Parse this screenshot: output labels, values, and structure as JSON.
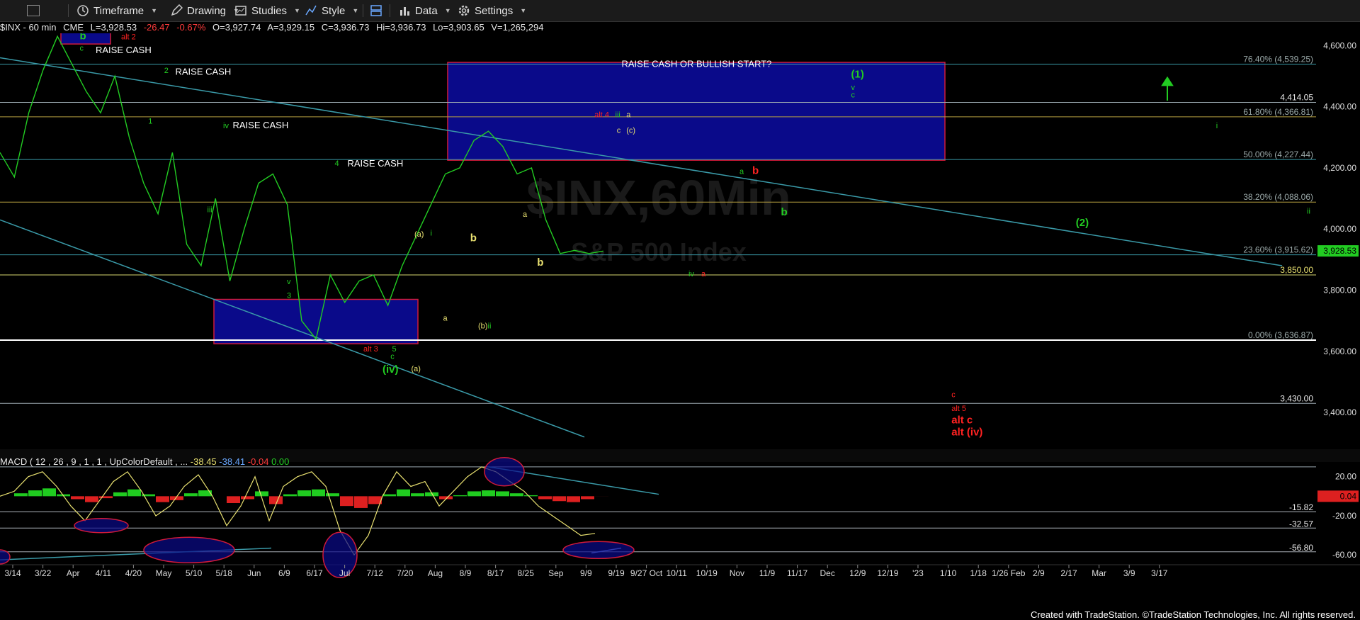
{
  "toolbar": {
    "timeframe": "Timeframe",
    "drawing": "Drawing",
    "studies": "Studies",
    "style": "Style",
    "data": "Data",
    "settings": "Settings"
  },
  "symbol_info": {
    "symbol": "$INX - 60 min",
    "exchange": "CME",
    "last": "L=3,928.53",
    "change": "-26.47",
    "change_pct": "-0.67%",
    "open": "O=3,927.74",
    "prev": "A=3,929.15",
    "close": "C=3,936.73",
    "high": "Hi=3,936.73",
    "low": "Lo=3,903.65",
    "volume": "V=1,265,294"
  },
  "macd_info": {
    "label": "MACD ( 12 , 26 , 9 , 1 , 1 , UpColorDefault , ...",
    "v1": "-38.45",
    "v2": "-38.41",
    "v3": "-0.04",
    "v4": "0.00"
  },
  "footer": "Created with TradeStation. ©TradeStation Technologies, Inc. All rights reserved.",
  "colors": {
    "price_line": "#22cc22",
    "box_fill": "#0a0a8a",
    "box_border": "#d01a3a",
    "trend_line": "#3a9aa8",
    "macd_line": "#e8e070",
    "hist_pos": "#20cc20",
    "hist_neg": "#dd2020"
  },
  "chart_data": {
    "type": "line",
    "title": "$INX,60Min",
    "subtitle": "S&P 500 Index",
    "x_ticks": [
      "3/14",
      "3/22",
      "Apr",
      "4/11",
      "4/20",
      "May",
      "5/10",
      "5/18",
      "Jun",
      "6/9",
      "6/17",
      "Jul",
      "7/12",
      "7/20",
      "Aug",
      "8/9",
      "8/17",
      "8/25",
      "Sep",
      "9/9",
      "9/19",
      "9/27 Oct",
      "10/11",
      "10/19",
      "Nov",
      "11/9",
      "11/17",
      "Dec",
      "12/9",
      "12/19",
      "'23",
      "1/10",
      "1/18",
      "1/26 Feb",
      "2/9",
      "2/17",
      "Mar",
      "3/9",
      "3/17"
    ],
    "price_ylim": [
      3280,
      4640
    ],
    "price_y_ticks": [
      "4,600.00",
      "4,400.00",
      "4,200.00",
      "4,000.00",
      "3,800.00",
      "3,600.00",
      "3,400.00"
    ],
    "price_y_values": [
      4600,
      4400,
      4200,
      4000,
      3800,
      3600,
      3400
    ],
    "last_price": "3,928.53",
    "series": [
      {
        "name": "",
        "x": [
          0,
          2,
          4,
          6,
          8,
          10,
          12,
          14,
          16,
          18,
          20,
          22,
          24,
          26,
          28,
          30,
          32,
          34,
          36,
          38,
          40,
          42,
          44,
          46,
          48,
          50,
          52,
          54,
          56,
          58,
          60,
          62,
          64,
          66,
          68,
          70,
          72,
          74,
          76,
          78,
          80,
          82,
          84
        ],
        "values": [
          4250,
          4170,
          4380,
          4520,
          4630,
          4540,
          4450,
          4380,
          4500,
          4300,
          4150,
          4050,
          4250,
          3950,
          3880,
          4100,
          3830,
          4000,
          4150,
          4180,
          4080,
          3700,
          3640,
          3850,
          3760,
          3830,
          3850,
          3750,
          3880,
          3980,
          4080,
          4180,
          4200,
          4290,
          4320,
          4270,
          4180,
          4200,
          4030,
          3920,
          3930,
          3920,
          3928
        ]
      }
    ],
    "fib_levels": [
      {
        "label": "76.40% (4,539.25)",
        "value": 4539.25
      },
      {
        "label": "4,414.05",
        "value": 4414.05
      },
      {
        "label": "61.80% (4,366.81)",
        "value": 4366.81
      },
      {
        "label": "50.00% (4,227.44)",
        "value": 4227.44
      },
      {
        "label": "38.20% (4,088.06)",
        "value": 4088.06
      },
      {
        "label": "23.60% (3,915.62)",
        "value": 3915.62
      },
      {
        "label": "3,850.00",
        "value": 3850
      },
      {
        "label": "0.00% (3,636.87)",
        "value": 3636.87
      },
      {
        "label": "3,430.00",
        "value": 3430
      }
    ],
    "annotations": [
      {
        "text": "b",
        "x": 5,
        "y": 4620,
        "color": "#22cc22"
      },
      {
        "text": "alt 2",
        "x": 7.6,
        "y": 4620,
        "color": "#ff2222"
      },
      {
        "text": "c",
        "x": 5,
        "y": 4583,
        "color": "#22cc22"
      },
      {
        "text": "RAISE CASH",
        "x": 6,
        "y": 4575,
        "color": "#ffffff"
      },
      {
        "text": "2",
        "x": 10.3,
        "y": 4510,
        "color": "#22cc22"
      },
      {
        "text": "RAISE CASH",
        "x": 11,
        "y": 4505,
        "color": "#ffffff"
      },
      {
        "text": "1",
        "x": 9.3,
        "y": 4345,
        "color": "#22cc22"
      },
      {
        "text": "iv",
        "x": 14,
        "y": 4330,
        "color": "#22cc22"
      },
      {
        "text": "RAISE CASH",
        "x": 14.6,
        "y": 4330,
        "color": "#ffffff"
      },
      {
        "text": "4",
        "x": 21,
        "y": 4207,
        "color": "#22cc22"
      },
      {
        "text": "RAISE CASH",
        "x": 21.8,
        "y": 4205,
        "color": "#ffffff"
      },
      {
        "text": "iii",
        "x": 13,
        "y": 4055,
        "color": "#22cc22"
      },
      {
        "text": "v",
        "x": 18,
        "y": 3820,
        "color": "#22cc22"
      },
      {
        "text": "3",
        "x": 18,
        "y": 3775,
        "color": "#22cc22"
      },
      {
        "text": "alt 3",
        "x": 22.8,
        "y": 3600,
        "color": "#ff2222"
      },
      {
        "text": "5",
        "x": 24.6,
        "y": 3600,
        "color": "#22cc22"
      },
      {
        "text": "c",
        "x": 24.5,
        "y": 3575,
        "color": "#22cc22"
      },
      {
        "text": "(iv)",
        "x": 24,
        "y": 3530,
        "color": "#22cc22"
      },
      {
        "text": "(a)",
        "x": 25.8,
        "y": 3535,
        "color": "#e8e070"
      },
      {
        "text": "(a)",
        "x": 26,
        "y": 3975,
        "color": "#e8e070"
      },
      {
        "text": "i",
        "x": 27,
        "y": 3978,
        "color": "#22cc22"
      },
      {
        "text": "a",
        "x": 27.8,
        "y": 3700,
        "color": "#e8e070"
      },
      {
        "text": "b",
        "x": 29.5,
        "y": 3960,
        "color": "#e8e070"
      },
      {
        "text": "(b)",
        "x": 30,
        "y": 3675,
        "color": "#e8e070"
      },
      {
        "text": "ii",
        "x": 30.6,
        "y": 3675,
        "color": "#22cc22"
      },
      {
        "text": "a",
        "x": 32.8,
        "y": 4040,
        "color": "#e8e070"
      },
      {
        "text": "b",
        "x": 33.7,
        "y": 3880,
        "color": "#e8e070"
      },
      {
        "text": "alt 4",
        "x": 37.3,
        "y": 4365,
        "color": "#ff2222"
      },
      {
        "text": "iii",
        "x": 38.6,
        "y": 4365,
        "color": "#22cc22"
      },
      {
        "text": "a",
        "x": 39.3,
        "y": 4365,
        "color": "#e8e070"
      },
      {
        "text": "c",
        "x": 38.7,
        "y": 4315,
        "color": "#e8e070"
      },
      {
        "text": "(c)",
        "x": 39.3,
        "y": 4315,
        "color": "#e8e070"
      },
      {
        "text": "a",
        "x": 46.4,
        "y": 4180,
        "color": "#22cc22"
      },
      {
        "text": "b",
        "x": 47.2,
        "y": 4180,
        "color": "#ff2222"
      },
      {
        "text": "b",
        "x": 49,
        "y": 4045,
        "color": "#22cc22"
      },
      {
        "text": "iv",
        "x": 43.2,
        "y": 3845,
        "color": "#22cc22"
      },
      {
        "text": "a",
        "x": 44,
        "y": 3845,
        "color": "#ff2222"
      },
      {
        "text": "RAISE CASH OR BULLISH START?",
        "x": 39,
        "y": 4530,
        "color": "#ffffff"
      },
      {
        "text": "(1)",
        "x": 53.4,
        "y": 4495,
        "color": "#22cc22"
      },
      {
        "text": "v",
        "x": 53.4,
        "y": 4455,
        "color": "#22cc22"
      },
      {
        "text": "c",
        "x": 53.4,
        "y": 4430,
        "color": "#22cc22"
      },
      {
        "text": "(2)",
        "x": 67.5,
        "y": 4010,
        "color": "#22cc22"
      },
      {
        "text": "i",
        "x": 76.3,
        "y": 4330,
        "color": "#22cc22"
      },
      {
        "text": "ii",
        "x": 82,
        "y": 4050,
        "color": "#22cc22"
      },
      {
        "text": "c",
        "x": 59.7,
        "y": 3450,
        "color": "#ff2222"
      },
      {
        "text": "alt 5",
        "x": 59.7,
        "y": 3405,
        "color": "#ff2222"
      },
      {
        "text": "alt c",
        "x": 59.7,
        "y": 3365,
        "color": "#ff2222"
      },
      {
        "text": "alt (iv)",
        "x": 59.7,
        "y": 3325,
        "color": "#ff2222"
      }
    ],
    "macd": {
      "ylim": [
        -70,
        35
      ],
      "y_ticks": [
        "20.00",
        "-20.00",
        "-60.00"
      ],
      "y_values": [
        20,
        -20,
        -60
      ],
      "levels": [
        {
          "label": "-15.82",
          "value": -15.82
        },
        {
          "label": "-32.57",
          "value": -32.57
        },
        {
          "label": "-56.80",
          "value": -56.8
        }
      ],
      "last": "0.04",
      "macd_line": [
        0,
        5,
        20,
        25,
        10,
        -10,
        -25,
        -5,
        15,
        25,
        5,
        -20,
        -10,
        10,
        22,
        0,
        -30,
        -10,
        20,
        -25,
        10,
        20,
        25,
        10,
        -35,
        -60,
        -40,
        0,
        25,
        10,
        15,
        -10,
        5,
        20,
        30,
        25,
        15,
        5,
        -10,
        -20,
        -30,
        -40,
        -38
      ],
      "histogram": [
        0,
        3,
        6,
        8,
        2,
        -3,
        -6,
        -2,
        4,
        7,
        2,
        -6,
        -4,
        3,
        6,
        0,
        -7,
        -3,
        5,
        -8,
        2,
        6,
        7,
        3,
        -10,
        -12,
        -8,
        2,
        7,
        3,
        4,
        -3,
        1,
        5,
        6,
        5,
        3,
        1,
        -3,
        -5,
        -6,
        -3,
        -0.04
      ]
    }
  }
}
